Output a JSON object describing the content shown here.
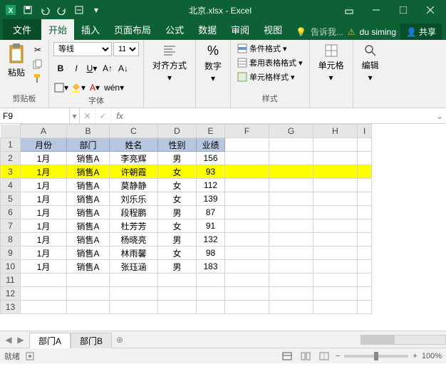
{
  "title": "北京.xlsx - Excel",
  "tabs": {
    "file": "文件",
    "home": "开始",
    "insert": "插入",
    "layout": "页面布局",
    "formulas": "公式",
    "data": "数据",
    "review": "审阅",
    "view": "视图"
  },
  "tell_me": "告诉我...",
  "user": "du siming",
  "share": "共享",
  "ribbon": {
    "clipboard": {
      "paste": "粘贴",
      "label": "剪贴板"
    },
    "font": {
      "name": "等线",
      "size": "11",
      "label": "字体",
      "wen": "wén"
    },
    "align": {
      "label": "对齐方式"
    },
    "number": {
      "label": "数字",
      "percent": "%"
    },
    "styles": {
      "cond": "条件格式",
      "table": "套用表格格式",
      "cell": "单元格样式",
      "label": "样式"
    },
    "cells": {
      "label": "单元格"
    },
    "editing": {
      "label": "编辑"
    }
  },
  "namebox": "F9",
  "fx_label": "fx",
  "columns": [
    "A",
    "B",
    "C",
    "D",
    "E",
    "F",
    "G",
    "H",
    "I"
  ],
  "headers": [
    "月份",
    "部门",
    "姓名",
    "性别",
    "业绩"
  ],
  "chart_data": {
    "type": "table",
    "title": "业绩",
    "columns": [
      "月份",
      "部门",
      "姓名",
      "性别",
      "业绩"
    ],
    "rows": [
      {
        "月份": "1月",
        "部门": "销售A",
        "姓名": "李亮辉",
        "性别": "男",
        "业绩": 156
      },
      {
        "月份": "1月",
        "部门": "销售A",
        "姓名": "许朝霞",
        "性别": "女",
        "业绩": 93
      },
      {
        "月份": "1月",
        "部门": "销售A",
        "姓名": "莫静静",
        "性别": "女",
        "业绩": 112
      },
      {
        "月份": "1月",
        "部门": "销售A",
        "姓名": "刘乐乐",
        "性别": "女",
        "业绩": 139
      },
      {
        "月份": "1月",
        "部门": "销售A",
        "姓名": "段程鹏",
        "性别": "男",
        "业绩": 87
      },
      {
        "月份": "1月",
        "部门": "销售A",
        "姓名": "杜芳芳",
        "性别": "女",
        "业绩": 91
      },
      {
        "月份": "1月",
        "部门": "销售A",
        "姓名": "杨晓亮",
        "性别": "男",
        "业绩": 132
      },
      {
        "月份": "1月",
        "部门": "销售A",
        "姓名": "林雨馨",
        "性别": "女",
        "业绩": 98
      },
      {
        "月份": "1月",
        "部门": "销售A",
        "姓名": "张珏涵",
        "性别": "男",
        "业绩": 183
      }
    ],
    "highlighted_row_index": 1
  },
  "sheets": {
    "a": "部门A",
    "b": "部门B"
  },
  "status": {
    "ready": "就绪",
    "zoom": "100%"
  }
}
